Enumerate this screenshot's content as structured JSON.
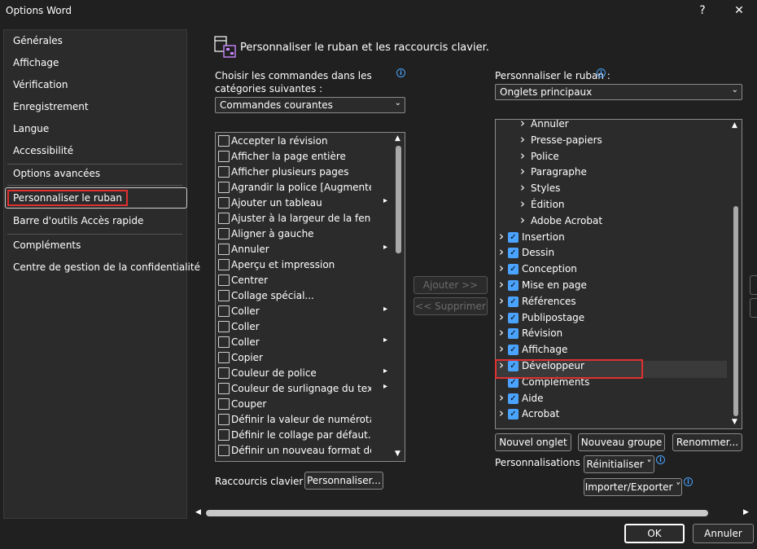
{
  "window": {
    "title": "Options Word",
    "help": "?",
    "close": "✕"
  },
  "nav": {
    "items": [
      "Générales",
      "Affichage",
      "Vérification",
      "Enregistrement",
      "Langue",
      "Accessibilité",
      "Options avancées",
      "Personnaliser le ruban",
      "Barre d'outils Accès rapide",
      "Compléments",
      "Centre de gestion de la confidentialité"
    ],
    "selected": "Personnaliser le ruban"
  },
  "main": {
    "heading": "Personnaliser le ruban et les raccourcis clavier.",
    "choose_label_line1": "Choisir les commandes dans les",
    "choose_label_line2": "catégories suivantes :",
    "choose_value": "Commandes courantes",
    "ribbon_label": "Personnaliser le ruban :",
    "ribbon_value": "Onglets principaux",
    "info": "i"
  },
  "commands": [
    {
      "label": "Accepter la révision",
      "sub": false
    },
    {
      "label": "Afficher la page entière",
      "sub": false
    },
    {
      "label": "Afficher plusieurs pages",
      "sub": false
    },
    {
      "label": "Agrandir la police [Augmenter...",
      "sub": false
    },
    {
      "label": "Ajouter un tableau",
      "sub": true
    },
    {
      "label": "Ajuster à la largeur de la fenêtre",
      "sub": false
    },
    {
      "label": "Aligner à gauche",
      "sub": false
    },
    {
      "label": "Annuler",
      "sub": true
    },
    {
      "label": "Aperçu et impression",
      "sub": false
    },
    {
      "label": "Centrer",
      "sub": false
    },
    {
      "label": "Collage spécial...",
      "sub": false
    },
    {
      "label": "Coller",
      "sub": true
    },
    {
      "label": "Coller",
      "sub": false
    },
    {
      "label": "Coller",
      "sub": true
    },
    {
      "label": "Copier",
      "sub": false
    },
    {
      "label": "Couleur de police",
      "sub": true
    },
    {
      "label": "Couleur de surlignage du texte",
      "sub": true
    },
    {
      "label": "Couper",
      "sub": false
    },
    {
      "label": "Définir la valeur de numérotati...",
      "sub": false
    },
    {
      "label": "Définir le collage par défaut...",
      "sub": false
    },
    {
      "label": "Définir un nouveau format de...",
      "sub": false
    }
  ],
  "mid_buttons": {
    "add": "Ajouter >>",
    "remove": "<< Supprimer"
  },
  "ribbon_tree": [
    {
      "label": "Annuler",
      "level": 1,
      "checked": false,
      "expand": true
    },
    {
      "label": "Presse-papiers",
      "level": 1,
      "checked": false,
      "expand": true
    },
    {
      "label": "Police",
      "level": 1,
      "checked": false,
      "expand": true
    },
    {
      "label": "Paragraphe",
      "level": 1,
      "checked": false,
      "expand": true
    },
    {
      "label": "Styles",
      "level": 1,
      "checked": false,
      "expand": true
    },
    {
      "label": "Édition",
      "level": 1,
      "checked": false,
      "expand": true
    },
    {
      "label": "Adobe Acrobat",
      "level": 1,
      "checked": false,
      "expand": true
    },
    {
      "label": "Insertion",
      "level": 0,
      "checked": true,
      "expand": true
    },
    {
      "label": "Dessin",
      "level": 0,
      "checked": true,
      "expand": true
    },
    {
      "label": "Conception",
      "level": 0,
      "checked": true,
      "expand": true
    },
    {
      "label": "Mise en page",
      "level": 0,
      "checked": true,
      "expand": true
    },
    {
      "label": "Références",
      "level": 0,
      "checked": true,
      "expand": true
    },
    {
      "label": "Publipostage",
      "level": 0,
      "checked": true,
      "expand": true
    },
    {
      "label": "Révision",
      "level": 0,
      "checked": true,
      "expand": true
    },
    {
      "label": "Affichage",
      "level": 0,
      "checked": true,
      "expand": true
    },
    {
      "label": "Développeur",
      "level": 0,
      "checked": true,
      "expand": true
    },
    {
      "label": "Compléments",
      "level": 0,
      "checked": true,
      "expand": false
    },
    {
      "label": "Aide",
      "level": 0,
      "checked": true,
      "expand": true
    },
    {
      "label": "Acrobat",
      "level": 0,
      "checked": true,
      "expand": true
    }
  ],
  "tree_buttons": {
    "new_tab": "Nouvel onglet",
    "new_group": "Nouveau groupe",
    "rename": "Renommer..."
  },
  "customizations": {
    "label": "Personnalisations :",
    "reset": "Réinitialiser ˅",
    "import_export": "Importer/Exporter ˅"
  },
  "shortcuts": {
    "label": "Raccourcis clavier :",
    "button": "Personnaliser..."
  },
  "footer": {
    "ok": "OK",
    "cancel": "Annuler"
  }
}
